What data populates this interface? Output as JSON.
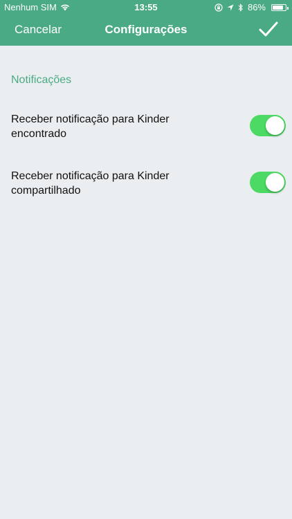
{
  "status_bar": {
    "carrier": "Nenhum SIM",
    "time": "13:55",
    "battery": "86%",
    "battery_level": 0.86,
    "icons": [
      "wifi-icon",
      "rotation-lock-icon",
      "location-icon",
      "bluetooth-icon",
      "battery-icon"
    ]
  },
  "nav": {
    "cancel_label": "Cancelar",
    "title": "Configurações",
    "confirm_icon": "checkmark-icon"
  },
  "section": {
    "title": "Notificações"
  },
  "settings": [
    {
      "label": "Receber notificação para Kinder encontrado",
      "enabled": true
    },
    {
      "label": "Receber notificação para Kinder compartilhado",
      "enabled": true
    }
  ],
  "colors": {
    "header": "#4aaa84",
    "accent": "#4aaa84",
    "toggle_on": "#4cd964",
    "background": "#ebeef1"
  }
}
